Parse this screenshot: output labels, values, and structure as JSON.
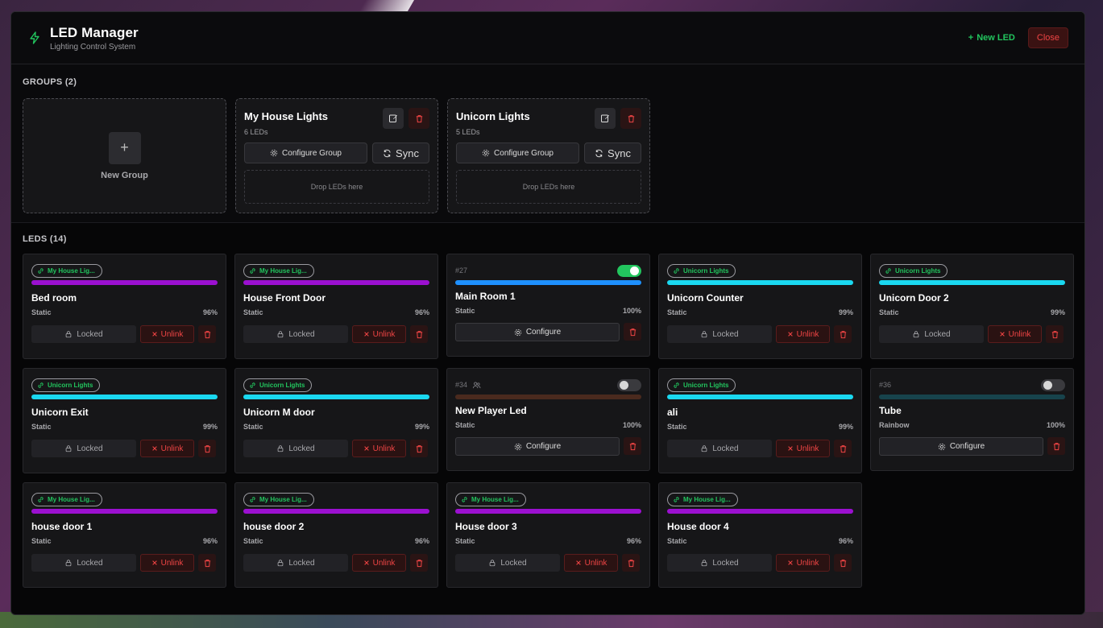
{
  "header": {
    "title": "LED Manager",
    "subtitle": "Lighting Control System",
    "new_led_label": "New LED",
    "close_label": "Close"
  },
  "groups_section": {
    "title": "GROUPS (2)",
    "new_group_label": "New Group",
    "groups": [
      {
        "name": "My House Lights",
        "count": "6 LEDs",
        "configure_label": "Configure Group",
        "sync_label": "Sync",
        "drop_label": "Drop LEDs here"
      },
      {
        "name": "Unicorn Lights",
        "count": "5 LEDs",
        "configure_label": "Configure Group",
        "sync_label": "Sync",
        "drop_label": "Drop LEDs here"
      }
    ]
  },
  "leds_section": {
    "title": "LEDS (14)",
    "locked_label": "Locked",
    "unlink_label": "Unlink",
    "configure_label": "Configure",
    "leds": [
      {
        "kind": "grouped",
        "group": "My House Lig...",
        "color": "#9b10d0",
        "name": "Bed room",
        "mode": "Static",
        "brightness": "96%"
      },
      {
        "kind": "grouped",
        "group": "My House Lig...",
        "color": "#9b10d0",
        "name": "House Front Door",
        "mode": "Static",
        "brightness": "96%"
      },
      {
        "kind": "solo",
        "id": "#27",
        "on": true,
        "color": "#1e90ff",
        "name": "Main Room 1",
        "mode": "Static",
        "brightness": "100%"
      },
      {
        "kind": "grouped",
        "group": "Unicorn Lights",
        "color": "#1ad8f0",
        "name": "Unicorn Counter",
        "mode": "Static",
        "brightness": "99%"
      },
      {
        "kind": "grouped",
        "group": "Unicorn Lights",
        "color": "#1ad8f0",
        "name": "Unicorn Door 2",
        "mode": "Static",
        "brightness": "99%"
      },
      {
        "kind": "grouped",
        "group": "Unicorn Lights",
        "color": "#1ad8f0",
        "name": "Unicorn Exit",
        "mode": "Static",
        "brightness": "99%"
      },
      {
        "kind": "grouped",
        "group": "Unicorn Lights",
        "color": "#1ad8f0",
        "name": "Unicorn M door",
        "mode": "Static",
        "brightness": "99%"
      },
      {
        "kind": "solo",
        "id": "#34",
        "on": false,
        "player_icon": true,
        "color": "#4a2a1e",
        "name": "New Player Led",
        "mode": "Static",
        "brightness": "100%"
      },
      {
        "kind": "grouped",
        "group": "Unicorn Lights",
        "color": "#1ad8f0",
        "name": "ali",
        "mode": "Static",
        "brightness": "99%"
      },
      {
        "kind": "solo",
        "id": "#36",
        "on": false,
        "color": "#17434c",
        "name": "Tube",
        "mode": "Rainbow",
        "brightness": "100%"
      },
      {
        "kind": "grouped",
        "group": "My House Lig...",
        "color": "#9b10d0",
        "name": "house door 1",
        "mode": "Static",
        "brightness": "96%"
      },
      {
        "kind": "grouped",
        "group": "My House Lig...",
        "color": "#9b10d0",
        "name": "house door 2",
        "mode": "Static",
        "brightness": "96%"
      },
      {
        "kind": "grouped",
        "group": "My House Lig...",
        "color": "#9b10d0",
        "name": "House door 3",
        "mode": "Static",
        "brightness": "96%"
      },
      {
        "kind": "grouped",
        "group": "My House Lig...",
        "color": "#9b10d0",
        "name": "House door 4",
        "mode": "Static",
        "brightness": "96%"
      }
    ]
  },
  "colors": {
    "accent_green": "#22c55e",
    "danger_red": "#ef4444"
  }
}
